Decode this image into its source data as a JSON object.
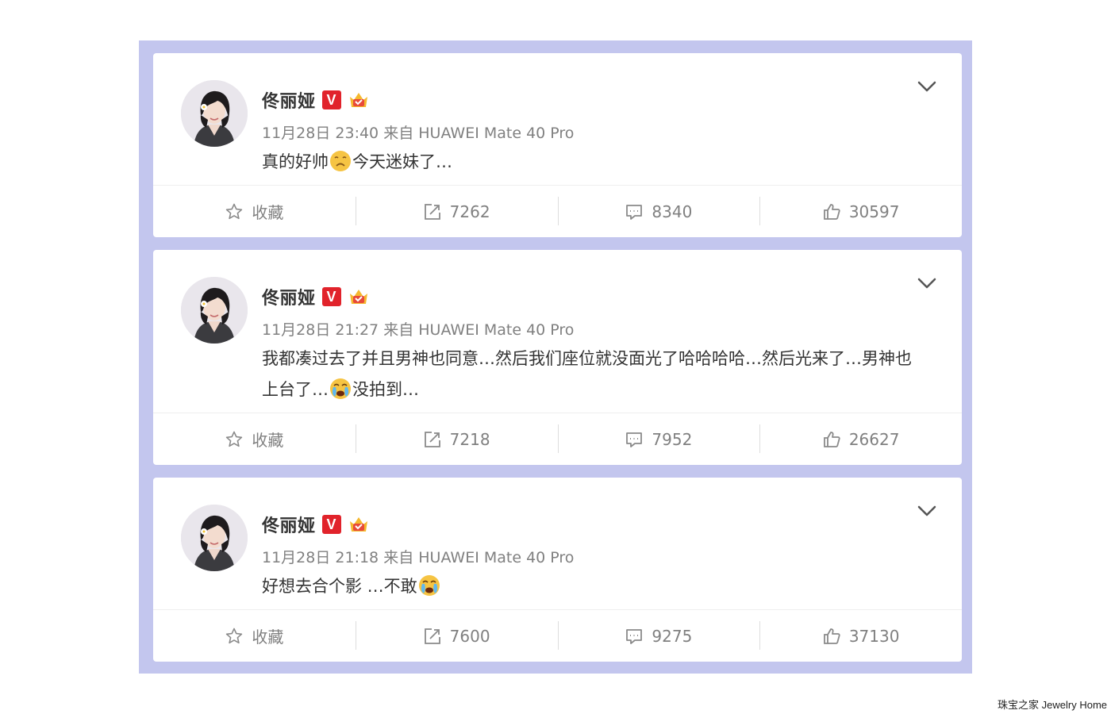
{
  "posts": [
    {
      "user_name": "佟丽娅",
      "verified_label": "V",
      "time": "11月28日 23:40",
      "source_prefix": "来自",
      "source": "HUAWEI Mate 40 Pro",
      "text_1": "真的好帅",
      "emoji_1": "sad-face-emoji",
      "text_2": "今天迷妹了…",
      "actions": {
        "favorite_label": "收藏",
        "reposts": "7262",
        "comments": "8340",
        "likes": "30597"
      }
    },
    {
      "user_name": "佟丽娅",
      "verified_label": "V",
      "time": "11月28日 21:27",
      "source_prefix": "来自",
      "source": "HUAWEI Mate 40 Pro",
      "text_1": "我都凑过去了并且男神也同意…然后我们座位就没面光了哈哈哈哈…然后光来了…男神也上台了…",
      "emoji_1": "crying-face-emoji",
      "text_2": "没拍到…",
      "actions": {
        "favorite_label": "收藏",
        "reposts": "7218",
        "comments": "7952",
        "likes": "26627"
      }
    },
    {
      "user_name": "佟丽娅",
      "verified_label": "V",
      "time": "11月28日 21:18",
      "source_prefix": "来自",
      "source": "HUAWEI Mate 40 Pro",
      "text_1": "好想去合个影 …不敢",
      "emoji_1": "crying-face-emoji",
      "text_2": "",
      "actions": {
        "favorite_label": "收藏",
        "reposts": "7600",
        "comments": "9275",
        "likes": "37130"
      }
    }
  ],
  "watermark": "珠宝之家  Jewelry Home",
  "colors": {
    "frame": "#c3c6ee",
    "verified": "#e1232b",
    "fan_badge": "#f5b82e",
    "meta_text": "#808080"
  },
  "icons": [
    "avatar",
    "verified-icon",
    "fan-badge-icon",
    "chevron-down-icon",
    "star-icon",
    "repost-icon",
    "comment-icon",
    "like-icon"
  ]
}
